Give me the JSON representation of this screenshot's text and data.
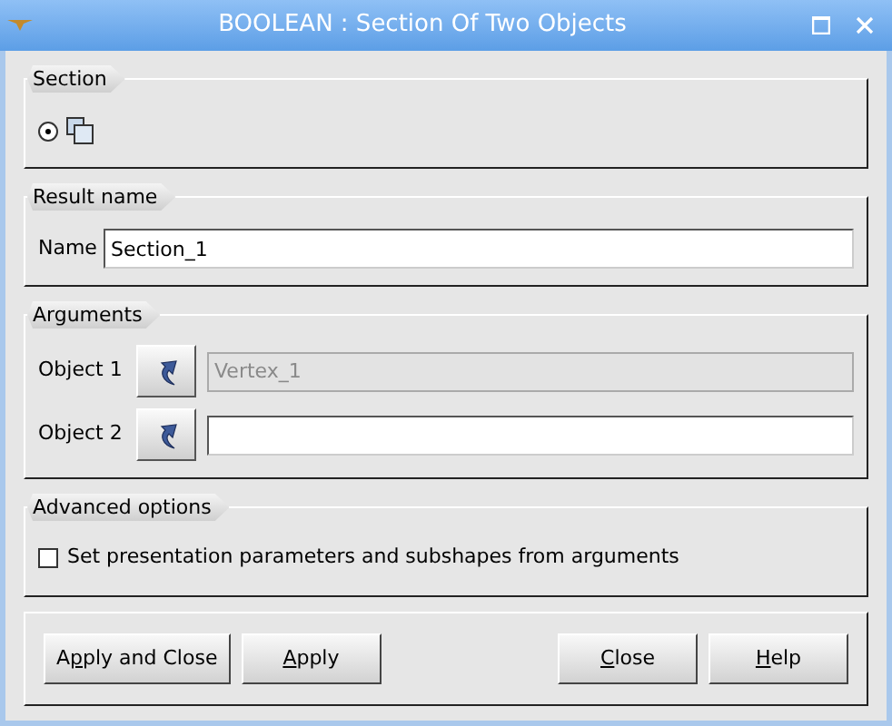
{
  "window": {
    "title": "BOOLEAN : Section Of Two Objects"
  },
  "section": {
    "title": "Section",
    "options": [
      {
        "selected": true
      }
    ]
  },
  "result_name": {
    "title": "Result name",
    "label": "Name",
    "value": "Section_1"
  },
  "arguments": {
    "title": "Arguments",
    "rows": [
      {
        "label": "Object 1",
        "value": "Vertex_1",
        "disabled": true
      },
      {
        "label": "Object 2",
        "disabled": false
      }
    ]
  },
  "advanced_options": {
    "title": "Advanced options",
    "checkbox": {
      "label": "Set presentation parameters and subshapes from arguments",
      "checked": false
    }
  },
  "buttons_left": [
    {
      "before": "A",
      "key": "p",
      "after": "ply and Close"
    },
    {
      "key": "A",
      "after": "pply"
    }
  ],
  "buttons_right": [
    {
      "key": "C",
      "after": "lose"
    },
    {
      "key": "H",
      "after": "elp"
    }
  ]
}
